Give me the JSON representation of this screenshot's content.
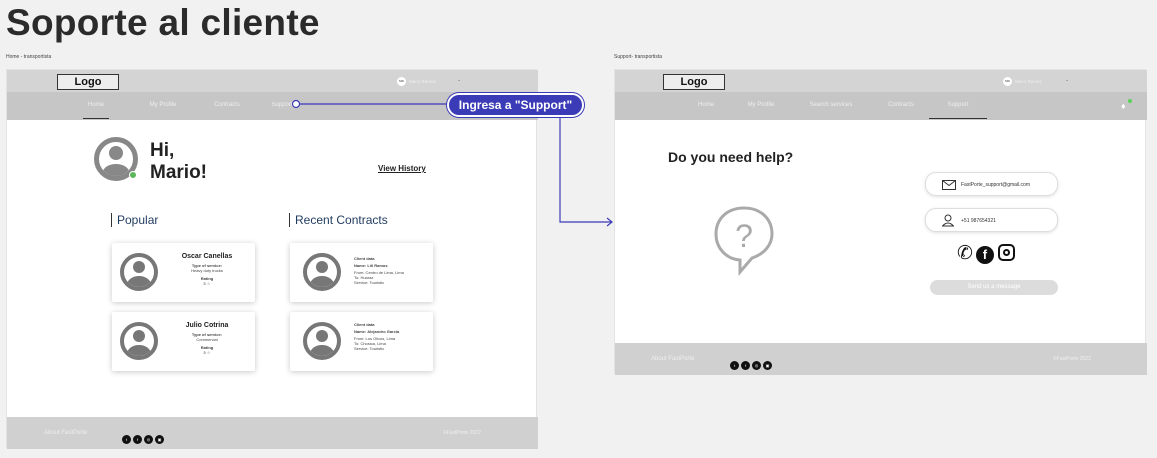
{
  "page_title": "Soporte al cliente",
  "left": {
    "breadcrumb": "Home - transportista",
    "logo": "Logo",
    "avatar_initials": "MR",
    "user_name": "Mario Ramos",
    "nav": [
      "Home",
      "My Profile",
      "Contracts",
      "Support"
    ],
    "greeting_line1": "Hi,",
    "greeting_line2": "Mario!",
    "view_history": "View History",
    "popular_title": "Popular",
    "recent_title": "Recent Contracts",
    "popular": [
      {
        "name": "Oscar Canellas",
        "service_label": "Type of service:",
        "service": "Heavy duty trucks",
        "rating_label": "Rating",
        "rating": "5 ☆"
      },
      {
        "name": "Julio Cotrina",
        "service_label": "Type of service:",
        "service": "Commercial",
        "rating_label": "Rating",
        "rating": "5 ☆"
      }
    ],
    "recent": [
      {
        "heading": "Client data",
        "name": "Name: Lili Ramos",
        "from": "From: Centro de Lima, Lima",
        "to": "To: Huaraz",
        "service": "Service: Touristic"
      },
      {
        "heading": "Client data",
        "name": "Name: Alejandro Garcia",
        "from": "From: Los Olivos, Lima",
        "to": "To: Chosica, Lima",
        "service": "Service: Touristic"
      }
    ],
    "footer_about": "About FastPorte",
    "footer_copy": "©FastPorte 2022",
    "social": [
      "twitter-icon",
      "facebook-icon",
      "instagram-icon",
      "other-icon"
    ]
  },
  "callout": "Ingresa a \"Support\"",
  "right": {
    "breadcrumb": "Support- transportista",
    "logo": "Logo",
    "avatar_initials": "MR",
    "user_name": "Mario Ramos",
    "nav": [
      "Home",
      "My Profile",
      "Search services",
      "Contracts",
      "Support"
    ],
    "help_title": "Do you need help?",
    "email": "FastPorte_support@gmail.com",
    "phone": "+51 987654321",
    "send_button": "Send us a message",
    "footer_about": "About FastPorte",
    "footer_copy": "©FastPorte 2022"
  },
  "colors": {
    "accent": "#3b3bb7",
    "nav_gray": "#c6c6c6",
    "heading_blue": "#1f3a5f"
  }
}
